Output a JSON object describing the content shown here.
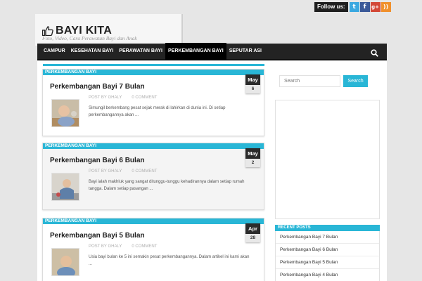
{
  "follow": {
    "label": "Follow us:",
    "icons": [
      {
        "name": "twitter-icon",
        "glyph": "t",
        "color": "#3aa8e0"
      },
      {
        "name": "facebook-icon",
        "glyph": "f",
        "color": "#3b5998"
      },
      {
        "name": "google-plus-icon",
        "glyph": "g+",
        "color": "#d34836"
      },
      {
        "name": "rss-icon",
        "glyph": "))",
        "color": "#f0902c"
      }
    ]
  },
  "site": {
    "title": "BAYI KITA",
    "tagline": "Foto, Video, Cara Perawatan Bayi dan Anak",
    "logo_icon": "thumbs-up-icon"
  },
  "nav": {
    "items": [
      "CAMPUR",
      "KESEHATAN BAYI",
      "PERAWATAN BAYI",
      "PERKEMBANGAN BAYI",
      "SEPUTAR ASI"
    ],
    "active_index": 3,
    "search_icon": "search-icon"
  },
  "posts": [
    {
      "category": "PERKEMBANGAN BAYI",
      "month": "May",
      "day": "6",
      "title": "Perkembangan Bayi 7 Bulan",
      "author": "POST BY GHALY",
      "comments": "0 COMMENT",
      "excerpt": "Simungil berkembang pesat sejak merak di lahirkan di dunia ini. Di setiap perkembangannya akan ..."
    },
    {
      "category": "PERKEMBANGAN BAYI",
      "month": "May",
      "day": "2",
      "title": "Perkembangan Bayi 6 Bulan",
      "author": "POST BY GHALY",
      "comments": "0 COMMENT",
      "excerpt": "Bayi ialah makhluk yang sangat ditunggu-tunggu kehadirannya dalam setiap rumah tangga. Dalam setiap pasangan ..."
    },
    {
      "category": "PERKEMBANGAN BAYI",
      "month": "Apr",
      "day": "28",
      "title": "Perkembangan Bayi 5 Bulan",
      "author": "POST BY GHALY",
      "comments": "0 COMMENT",
      "excerpt": "Usia bayi bulan ke 5 ini semakin pesat perkembangannya. Dalam artikel ini kami akan ..."
    }
  ],
  "sidebar": {
    "search_placeholder": "Search",
    "search_button": "Search",
    "recent_title": "RECENT POSTS",
    "recent": [
      "Perkembangan Bayi 7 Bulan",
      "Perkembangan Bayi 6 Bulan",
      "Perkembangan Bayi 5 Bulan",
      "Perkembangan Bayi 4 Bulan"
    ]
  },
  "colors": {
    "accent": "#29b6d6",
    "nav_bg": "#232323",
    "nav_active": "#000000"
  }
}
